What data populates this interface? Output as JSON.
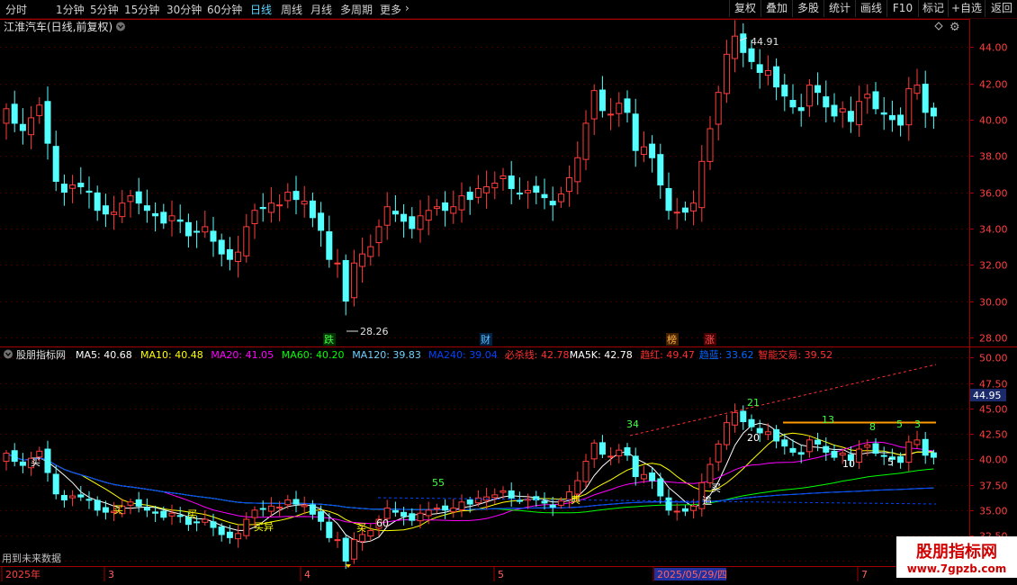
{
  "toolbar": {
    "periods": [
      "分时",
      "1分钟",
      "5分钟",
      "15分钟",
      "30分钟",
      "60分钟",
      "日线",
      "周线",
      "月线",
      "多周期",
      "更多"
    ],
    "active_period": "日线",
    "more_chevron": "chevron-right-icon",
    "buttons": [
      "复权",
      "叠加",
      "多股",
      "统计",
      "画线",
      "F10",
      "标记",
      "+自选",
      "返回"
    ]
  },
  "main_chart": {
    "title": "江淮汽车(日线,前复权)",
    "high_label": "44.91",
    "low_label": "28.26",
    "event_markers": [
      "跌",
      "财",
      "榜",
      "涨"
    ]
  },
  "indicator": {
    "name": "股朋指标网",
    "items": [
      {
        "label": "MA5: 40.68",
        "color": "#ffffff"
      },
      {
        "label": "MA10: 40.48",
        "color": "#ffff00"
      },
      {
        "label": "MA20: 41.05",
        "color": "#ff00ff"
      },
      {
        "label": "MA60: 40.20",
        "color": "#00ff00"
      },
      {
        "label": "MA120: 39.83",
        "color": "#6fd0ff"
      },
      {
        "label": "MA240: 39.04",
        "color": "#0044ff"
      },
      {
        "label": "必杀线: 42.78",
        "color": "#ff3030"
      },
      {
        "label": "MA5K: 42.78",
        "color": "#ffffff"
      },
      {
        "label": "趋红: 49.47",
        "color": "#ff3030"
      },
      {
        "label": "趋蓝: 33.62",
        "color": "#0066ff"
      },
      {
        "label": "智能交易: 39.52",
        "color": "#ff3030"
      }
    ],
    "current_price": "44.95",
    "future_data_note": "用到未来数据",
    "signals": [
      "买",
      "买",
      "买",
      "买异",
      "买",
      "60",
      "55",
      "典",
      "34",
      "21",
      "20",
      "13",
      "8",
      "5",
      "3",
      "10",
      "5",
      "追",
      "买"
    ]
  },
  "time_axis": {
    "labels": [
      "2025年",
      "3",
      "4",
      "5",
      "2025/05/29/四",
      "7"
    ],
    "cursor_date": "2025/05/29/四"
  },
  "watermark": {
    "name": "股朋指标网",
    "url": "www.7gpzb.com"
  },
  "colors": {
    "up": "#ff3c3c",
    "down": "#54ffff",
    "axis": "#a00000",
    "bg": "#000000"
  },
  "chart_data": [
    {
      "type": "candlestick",
      "title": "江淮汽车(日线,前复权)",
      "ylim": [
        27.5,
        45.5
      ],
      "y_ticks": [
        28.0,
        30.0,
        32.0,
        34.0,
        36.0,
        38.0,
        40.0,
        42.0,
        44.0
      ],
      "close": [
        40.6,
        39.8,
        39.4,
        40.1,
        40.8,
        38.7,
        36.6,
        36.0,
        36.4,
        36.3,
        36.0,
        35.0,
        34.8,
        34.9,
        35.4,
        35.8,
        35.4,
        35.0,
        34.7,
        34.3,
        34.7,
        34.4,
        33.6,
        33.8,
        34.1,
        33.3,
        32.6,
        32.3,
        32.7,
        34.1,
        35.0,
        35.1,
        35.4,
        35.3,
        36.0,
        35.6,
        35.5,
        34.6,
        33.9,
        32.3,
        32.1,
        30.0,
        32.1,
        32.6,
        33.0,
        34.1,
        35.2,
        34.8,
        34.4,
        34.0,
        34.7,
        35.0,
        35.2,
        35.0,
        35.2,
        35.8,
        35.6,
        36.2,
        36.3,
        36.5,
        36.9,
        36.2,
        35.9,
        36.1,
        36.0,
        35.7,
        35.3,
        35.9,
        36.8,
        37.9,
        39.8,
        41.6,
        40.5,
        40.3,
        40.9,
        40.4,
        38.3,
        38.5,
        37.9,
        36.4,
        35.0,
        34.9,
        34.9,
        35.4,
        37.7,
        39.5,
        41.5,
        43.6,
        44.6,
        43.7,
        43.2,
        42.6,
        42.7,
        41.8,
        41.3,
        40.7,
        40.5,
        41.9,
        41.5,
        40.7,
        40.2,
        40.6,
        39.9,
        41.0,
        41.4,
        40.6,
        40.3,
        40.0,
        39.7,
        41.7,
        41.9,
        40.4,
        40.2
      ],
      "high_marker": 44.91,
      "low_marker": 28.26
    },
    {
      "type": "line",
      "title": "股朋指标网",
      "ylim": [
        29.5,
        51.0
      ],
      "y_ticks": [
        30.0,
        32.5,
        35.0,
        37.5,
        40.0,
        42.5,
        45.0,
        47.5,
        50.0
      ],
      "series": [
        {
          "name": "MA5",
          "value": 40.68
        },
        {
          "name": "MA10",
          "value": 40.48
        },
        {
          "name": "MA20",
          "value": 41.05
        },
        {
          "name": "MA60",
          "value": 40.2
        },
        {
          "name": "MA120",
          "value": 39.83
        },
        {
          "name": "MA240",
          "value": 39.04
        },
        {
          "name": "必杀线",
          "value": 42.78
        },
        {
          "name": "MA5K",
          "value": 42.78
        },
        {
          "name": "趋红",
          "value": 49.47
        },
        {
          "name": "趋蓝",
          "value": 33.62
        },
        {
          "name": "智能交易",
          "value": 39.52
        }
      ]
    }
  ]
}
